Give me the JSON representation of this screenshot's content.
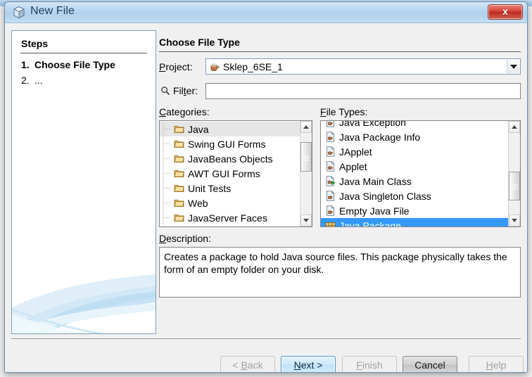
{
  "window": {
    "title": "New File",
    "title_icon": "cube-icon",
    "close_label": "x"
  },
  "steps": {
    "heading": "Steps",
    "items": [
      {
        "num": "1.",
        "label": "Choose File Type",
        "current": true
      },
      {
        "num": "2.",
        "label": "...",
        "current": false
      }
    ]
  },
  "content": {
    "heading": "Choose File Type"
  },
  "project": {
    "label_pre": "P",
    "label_post": "roject:",
    "icon": "coffee-cup-icon",
    "value": "Sklep_6SE_1",
    "arrow_icon": "chevron-down-icon"
  },
  "filter": {
    "icon": "search-icon",
    "label_pre": "Fil",
    "label_mn": "t",
    "label_post": "er:",
    "value": "",
    "placeholder": ""
  },
  "categories": {
    "label_mn": "C",
    "label_post": "ategories:",
    "items": [
      {
        "label": "Java",
        "icon": "folder-icon",
        "selected": true
      },
      {
        "label": "Swing GUI Forms",
        "icon": "folder-icon",
        "selected": false
      },
      {
        "label": "JavaBeans Objects",
        "icon": "folder-icon",
        "selected": false
      },
      {
        "label": "AWT GUI Forms",
        "icon": "folder-icon",
        "selected": false
      },
      {
        "label": "Unit Tests",
        "icon": "folder-icon",
        "selected": false
      },
      {
        "label": "Web",
        "icon": "folder-icon",
        "selected": false
      },
      {
        "label": "JavaServer Faces",
        "icon": "folder-icon",
        "selected": false
      }
    ],
    "scroll_thumb_top_pct": 11,
    "scroll_thumb_height_pct": 36
  },
  "filetypes": {
    "label_mn": "F",
    "label_post": "ile Types:",
    "items": [
      {
        "label": "Java Exception",
        "icon": "java-file-icon",
        "selected": false,
        "clipped": true
      },
      {
        "label": "Java Package Info",
        "icon": "java-file-icon",
        "selected": false
      },
      {
        "label": "JApplet",
        "icon": "java-file-icon",
        "selected": false
      },
      {
        "label": "Applet",
        "icon": "java-file-icon",
        "selected": false
      },
      {
        "label": "Java Main Class",
        "icon": "java-main-class-icon",
        "selected": false
      },
      {
        "label": "Java Singleton Class",
        "icon": "java-file-icon",
        "selected": false
      },
      {
        "label": "Empty Java File",
        "icon": "java-file-icon",
        "selected": false
      },
      {
        "label": "Java Package",
        "icon": "java-package-icon",
        "selected": true
      }
    ],
    "scroll_thumb_top_pct": 47,
    "scroll_thumb_height_pct": 36
  },
  "description": {
    "label_mn": "D",
    "label_post": "escription:",
    "text": "Creates a package to hold Java source files. This package physically takes the form of an empty folder on your disk."
  },
  "buttons": [
    {
      "name": "back",
      "label_pre": "< ",
      "label_mn": "B",
      "label_post": "ack",
      "state": "disabled"
    },
    {
      "name": "next",
      "label_pre": "",
      "label_mn": "N",
      "label_post": "ext >",
      "state": "default"
    },
    {
      "name": "finish",
      "label_pre": "",
      "label_mn": "F",
      "label_post": "inish",
      "state": "disabled"
    },
    {
      "name": "cancel",
      "label_pre": "",
      "label_mn": "",
      "label_post": "Cancel",
      "state": "hover"
    },
    {
      "name": "help",
      "label_pre": "",
      "label_mn": "H",
      "label_post": "elp",
      "state": "disabled"
    }
  ],
  "colors": {
    "titlebar": "#b0d0ec",
    "close_red": "#d9483c",
    "selection_blue": "#3399ff",
    "selection_grey": "#e6e6e6",
    "dialog_bg": "#f0f0f0",
    "default_button_blue": "#cde8fb"
  }
}
